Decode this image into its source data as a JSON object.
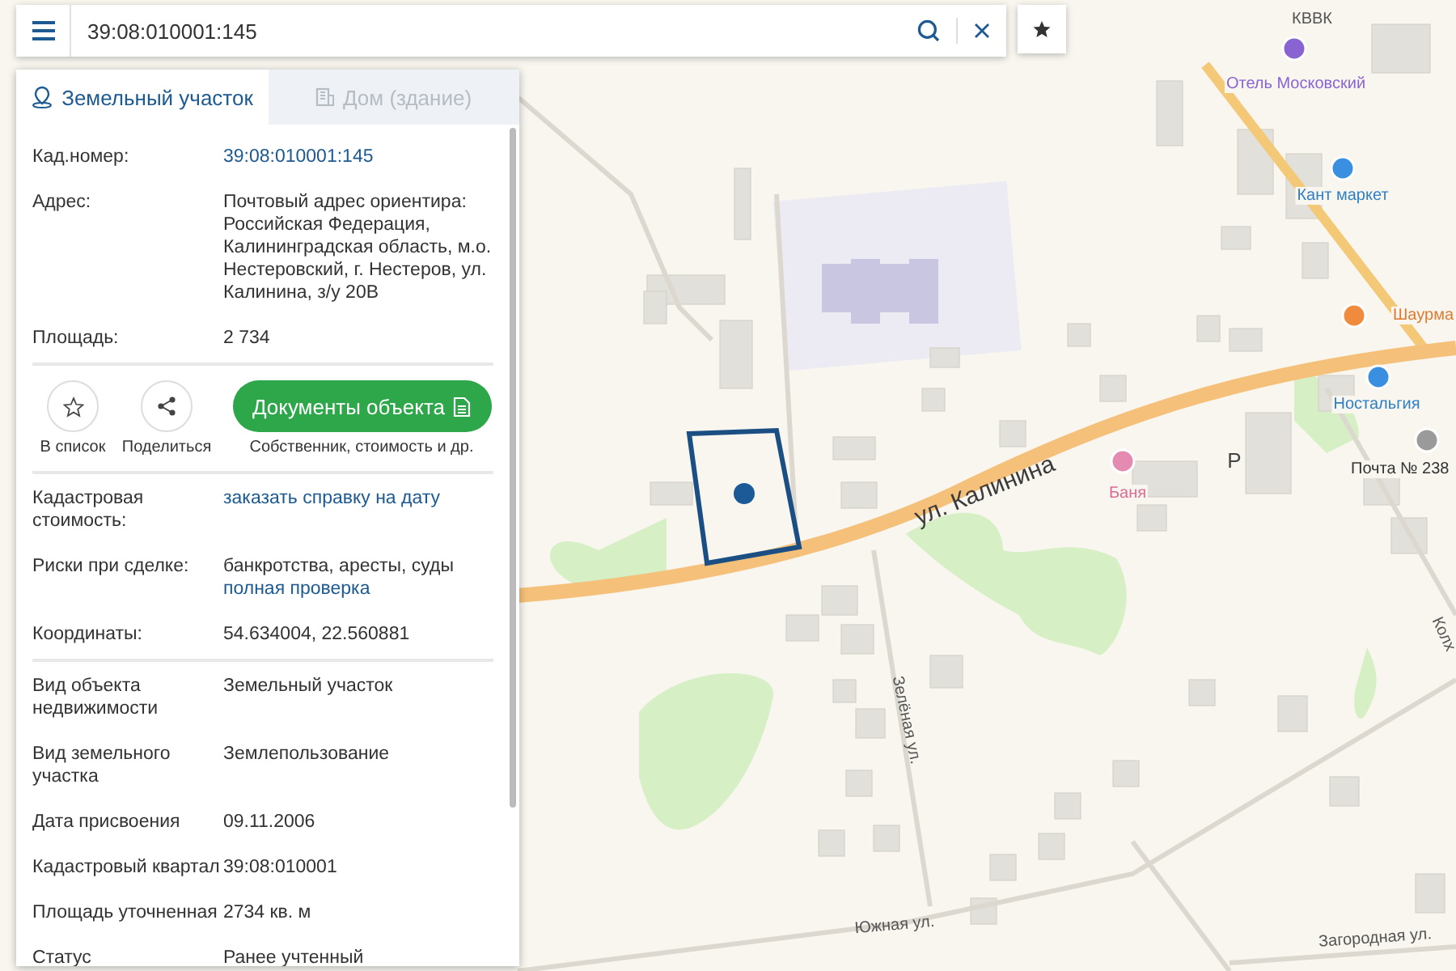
{
  "search": {
    "value": "39:08:010001:145"
  },
  "tabs": [
    {
      "label": "Земельный участок",
      "kind": "land",
      "selected": true
    },
    {
      "label": "Дом (здание)",
      "kind": "building",
      "selected": false
    }
  ],
  "summary": [
    {
      "label": "Кад.номер:",
      "value": "39:08:010001:145",
      "kind": "link"
    },
    {
      "label": "Адрес:",
      "value": "Почтовый адрес ориентира: Российская Федерация, Калининградская область, м.о. Нестеровский, г. Нестеров, ул. Калинина, з/у 20В",
      "kind": "text"
    },
    {
      "label": "Площадь:",
      "value": "2 734",
      "kind": "text"
    }
  ],
  "actions": [
    {
      "label": "В список",
      "kind": "favorite"
    },
    {
      "label": "Поделиться",
      "kind": "share"
    }
  ],
  "documents_button": {
    "label": "Документы объекта",
    "caption": "Собственник, стоимость и др."
  },
  "details": [
    {
      "label": "Кадастровая стоимость:",
      "value": "заказать справку на дату",
      "kind": "link"
    },
    {
      "label": "Риски при сделке:",
      "value": "банкротства, аресты, суды",
      "link": "полная проверка",
      "kind": "text"
    },
    {
      "label": "Координаты:",
      "value": "54.634004, 22.560881",
      "kind": "text"
    }
  ],
  "properties": [
    {
      "label": "Вид объекта недвижимости",
      "value": "Земельный участок"
    },
    {
      "label": "Вид земельного участка",
      "value": "Землепользование"
    },
    {
      "label": "Дата присвоения",
      "value": "09.11.2006"
    },
    {
      "label": "Кадастровый квартал",
      "value": "39:08:010001"
    },
    {
      "label": "Площадь уточненная",
      "value": "2734 кв. м"
    },
    {
      "label": "Статус",
      "value": "Ранее учтенный"
    }
  ],
  "map": {
    "streets": [
      "ул. Калинина",
      "Зелёная ул.",
      "Южная ул.",
      "Загородная ул.",
      "Колх"
    ],
    "places": [
      {
        "name": "КВВК",
        "kind": "label"
      },
      {
        "name": "Отель Московский",
        "kind": "hotel"
      },
      {
        "name": "Кант маркет",
        "kind": "shop"
      },
      {
        "name": "Шаурма",
        "kind": "food"
      },
      {
        "name": "Ностальгия",
        "kind": "shop"
      },
      {
        "name": "Баня",
        "kind": "bath"
      },
      {
        "name": "Почта № 238",
        "kind": "post"
      },
      {
        "name": "P",
        "kind": "parking"
      }
    ]
  }
}
